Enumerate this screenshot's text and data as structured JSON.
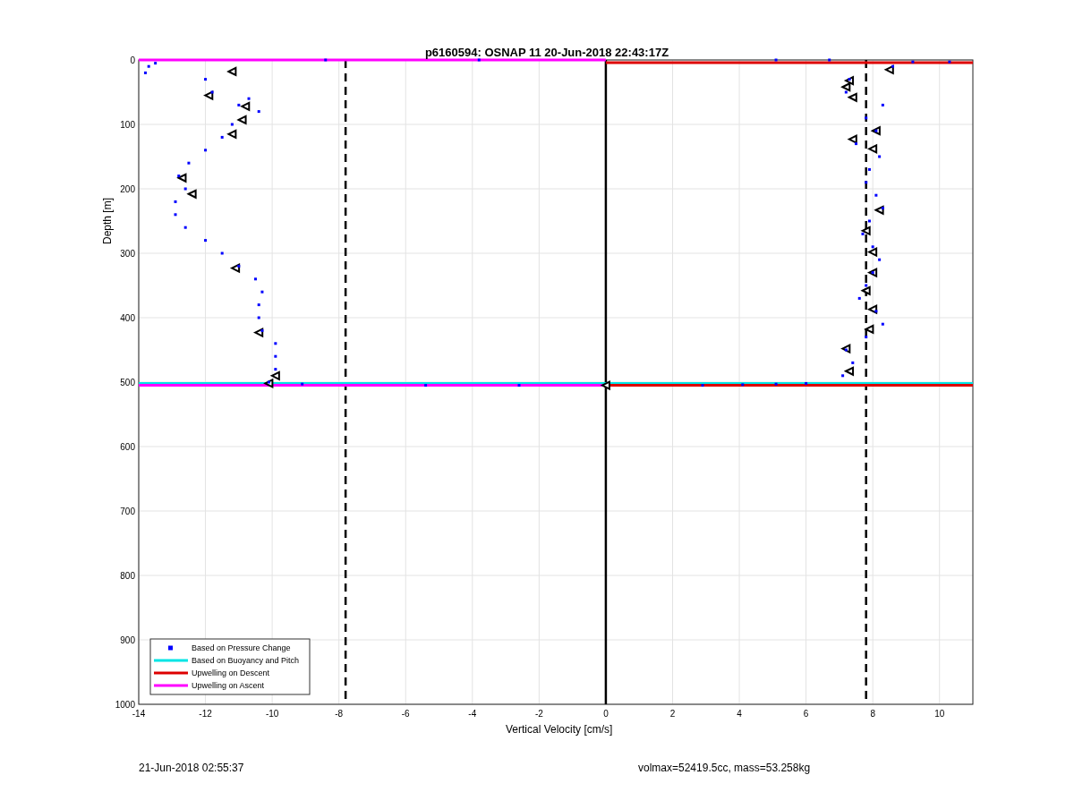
{
  "chart_data": {
    "type": "scatter",
    "title": "p6160594: OSNAP 11 20-Jun-2018 22:43:17Z",
    "xlabel": "Vertical Velocity [cm/s]",
    "ylabel": "Depth [m]",
    "xlim": [
      -14,
      11
    ],
    "ylim": [
      1000,
      0
    ],
    "xticks": [
      -14,
      -12,
      -10,
      -8,
      -6,
      -4,
      -2,
      0,
      2,
      4,
      6,
      8,
      10
    ],
    "yticks": [
      0,
      100,
      200,
      300,
      400,
      500,
      600,
      700,
      800,
      900,
      1000
    ],
    "grid": true,
    "legend": true,
    "x": [
      -13.7,
      -13.8,
      -13.5,
      -12,
      -11.8,
      -11,
      -10.4,
      -10.7,
      -11.2,
      -11.5,
      -12,
      -12.5,
      -12.8,
      -12.6,
      -12.9,
      -12.9,
      -12.6,
      -12,
      -11.5,
      -11,
      -10.5,
      -10.3,
      -10.4,
      -10.4,
      -10.3,
      -9.9,
      -9.9,
      -9.9,
      -10.1,
      -8.4,
      -3.8,
      -9.1,
      -5.4,
      -2.6,
      5.1,
      6.7,
      9.2,
      10.3,
      8.6,
      7.3,
      7.2,
      8.3,
      7.8,
      8.1,
      7.5,
      8.2,
      7.9,
      7.8,
      8.1,
      8.3,
      7.9,
      7.7,
      8,
      8.2,
      8,
      7.8,
      7.6,
      8.1,
      8.3,
      7.8,
      7.2,
      7.4,
      7.1,
      2.9,
      4.1,
      5.1,
      6,
      -14,
      0,
      11,
      -11.2,
      -11.9,
      -10.8,
      -10.9,
      -11.2,
      -12.7,
      -12.4,
      -11.1,
      -10.4,
      -9.9,
      -10.1,
      8.5,
      7.3,
      7.2,
      7.4,
      8.1,
      7.4,
      8,
      8.2,
      7.8,
      8,
      8,
      7.8,
      8,
      7.9,
      7.2,
      7.3
    ],
    "series": [
      {
        "name": "Based on Pressure Change",
        "color": "#0000ff",
        "type": "scatter",
        "marker": "square",
        "values": [
          10,
          20,
          5,
          30,
          50,
          70,
          80,
          60,
          100,
          120,
          140,
          160,
          180,
          200,
          220,
          240,
          260,
          280,
          300,
          320,
          340,
          360,
          380,
          400,
          420,
          440,
          460,
          480,
          500,
          0,
          0,
          503,
          505,
          505,
          0,
          0,
          3,
          3,
          10,
          30,
          50,
          70,
          90,
          110,
          130,
          150,
          170,
          190,
          210,
          230,
          250,
          270,
          290,
          310,
          330,
          350,
          370,
          390,
          410,
          430,
          450,
          470,
          490,
          505,
          504,
          503,
          502,
          null,
          null,
          null,
          null,
          null,
          null,
          null,
          null,
          null,
          null,
          null,
          null,
          null,
          null,
          null,
          null,
          null,
          null,
          null,
          null,
          null,
          null,
          null,
          null,
          null,
          null,
          null,
          null,
          null,
          null
        ]
      },
      {
        "name": "Based on Buoyancy and Pitch",
        "color": "#00e5e5",
        "type": "line",
        "values": [
          null,
          null,
          null,
          null,
          null,
          null,
          null,
          null,
          null,
          null,
          null,
          null,
          null,
          null,
          null,
          null,
          null,
          null,
          null,
          null,
          null,
          null,
          null,
          null,
          null,
          null,
          null,
          null,
          null,
          null,
          null,
          null,
          null,
          null,
          null,
          null,
          null,
          null,
          null,
          null,
          null,
          null,
          null,
          null,
          null,
          null,
          null,
          null,
          null,
          null,
          null,
          null,
          null,
          null,
          null,
          null,
          null,
          null,
          null,
          null,
          null,
          null,
          null,
          null,
          null,
          null,
          null,
          502,
          502,
          502,
          null,
          null,
          null,
          null,
          null,
          null,
          null,
          null,
          null,
          null,
          null,
          null,
          null,
          null,
          null,
          null,
          null,
          null,
          null,
          null,
          null,
          null,
          null,
          null,
          null,
          null,
          null
        ]
      },
      {
        "name": "Upwelling on Descent",
        "color": "#dd0000",
        "type": "line",
        "values": [
          null,
          null,
          null,
          null,
          null,
          null,
          null,
          null,
          null,
          null,
          null,
          null,
          null,
          null,
          null,
          null,
          null,
          null,
          null,
          null,
          null,
          null,
          null,
          null,
          null,
          null,
          null,
          null,
          null,
          null,
          null,
          null,
          null,
          null,
          null,
          null,
          null,
          null,
          null,
          null,
          null,
          null,
          null,
          null,
          null,
          null,
          null,
          null,
          null,
          null,
          null,
          null,
          null,
          null,
          null,
          null,
          null,
          null,
          null,
          null,
          null,
          null,
          null,
          null,
          null,
          null,
          null,
          null,
          4,
          4,
          null,
          null,
          null,
          null,
          null,
          null,
          null,
          null,
          null,
          null,
          null,
          null,
          null,
          null,
          null,
          null,
          null,
          null,
          null,
          null,
          null,
          null,
          null,
          null,
          null,
          null,
          null
        ]
      },
      {
        "name": "Upwelling on Ascent",
        "color": "#ff00ff",
        "type": "line",
        "values": [
          null,
          null,
          null,
          null,
          null,
          null,
          null,
          null,
          null,
          null,
          null,
          null,
          null,
          null,
          null,
          null,
          null,
          null,
          null,
          null,
          null,
          null,
          null,
          null,
          null,
          null,
          null,
          null,
          null,
          null,
          null,
          null,
          null,
          null,
          null,
          null,
          null,
          null,
          null,
          null,
          null,
          null,
          null,
          null,
          null,
          null,
          null,
          null,
          null,
          null,
          null,
          null,
          null,
          null,
          null,
          null,
          null,
          null,
          null,
          null,
          null,
          null,
          null,
          null,
          null,
          null,
          null,
          0,
          0,
          null,
          null,
          null,
          null,
          null,
          null,
          null,
          null,
          null,
          null,
          null,
          null,
          null,
          null,
          null,
          null,
          null,
          null,
          null,
          null,
          null,
          null,
          null,
          null,
          null,
          null,
          null,
          null
        ]
      },
      {
        "color": "#dd0000",
        "type": "line",
        "values": [
          null,
          null,
          null,
          null,
          null,
          null,
          null,
          null,
          null,
          null,
          null,
          null,
          null,
          null,
          null,
          null,
          null,
          null,
          null,
          null,
          null,
          null,
          null,
          null,
          null,
          null,
          null,
          null,
          null,
          null,
          null,
          null,
          null,
          null,
          null,
          null,
          null,
          null,
          null,
          null,
          null,
          null,
          null,
          null,
          null,
          null,
          null,
          null,
          null,
          null,
          null,
          null,
          null,
          null,
          null,
          null,
          null,
          null,
          null,
          null,
          null,
          null,
          null,
          null,
          null,
          null,
          null,
          null,
          505,
          505,
          null,
          null,
          null,
          null,
          null,
          null,
          null,
          null,
          null,
          null,
          null,
          null,
          null,
          null,
          null,
          null,
          null,
          null,
          null,
          null,
          null,
          null,
          null,
          null,
          null,
          null,
          null
        ]
      },
      {
        "color": "#ff00ff",
        "type": "line",
        "values": [
          null,
          null,
          null,
          null,
          null,
          null,
          null,
          null,
          null,
          null,
          null,
          null,
          null,
          null,
          null,
          null,
          null,
          null,
          null,
          null,
          null,
          null,
          null,
          null,
          null,
          null,
          null,
          null,
          null,
          null,
          null,
          null,
          null,
          null,
          null,
          null,
          null,
          null,
          null,
          null,
          null,
          null,
          null,
          null,
          null,
          null,
          null,
          null,
          null,
          null,
          null,
          null,
          null,
          null,
          null,
          null,
          null,
          null,
          null,
          null,
          null,
          null,
          null,
          null,
          null,
          null,
          null,
          505,
          505,
          null,
          null,
          null,
          null,
          null,
          null,
          null,
          null,
          null,
          null,
          null,
          null,
          null,
          null,
          null,
          null,
          null,
          null,
          null,
          null,
          null,
          null,
          null,
          null,
          null,
          null,
          null,
          null
        ]
      },
      {
        "color": "#000000",
        "type": "scatter",
        "marker": "triangle",
        "values": [
          null,
          null,
          null,
          null,
          null,
          null,
          null,
          null,
          null,
          null,
          null,
          null,
          null,
          null,
          null,
          null,
          null,
          null,
          null,
          null,
          null,
          null,
          null,
          null,
          null,
          null,
          null,
          null,
          null,
          null,
          null,
          null,
          null,
          null,
          null,
          null,
          null,
          null,
          null,
          null,
          null,
          null,
          null,
          null,
          null,
          null,
          null,
          null,
          null,
          null,
          null,
          null,
          null,
          null,
          null,
          null,
          null,
          null,
          null,
          null,
          null,
          null,
          null,
          null,
          null,
          null,
          null,
          null,
          505,
          null,
          18,
          55,
          72,
          93,
          115,
          183,
          208,
          323,
          423,
          490,
          502,
          15,
          32,
          42,
          58,
          110,
          123,
          138,
          233,
          265,
          298,
          330,
          358,
          387,
          418,
          448,
          483
        ]
      }
    ],
    "ref_lines": [
      {
        "axis": "x",
        "value": -7.8
      },
      {
        "axis": "x",
        "value": 0
      },
      {
        "axis": "x",
        "value": 7.8
      }
    ]
  },
  "footer": {
    "left": "21-Jun-2018 02:55:37",
    "right": "volmax=52419.5cc, mass=53.258kg"
  }
}
